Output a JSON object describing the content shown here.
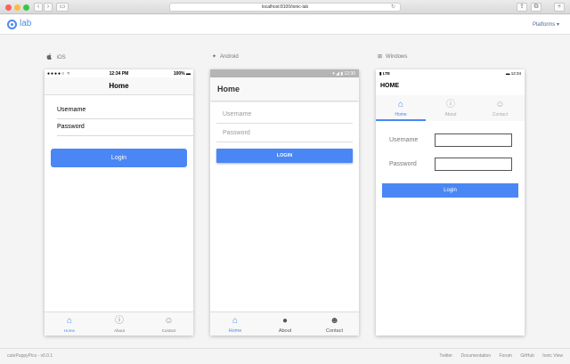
{
  "browser": {
    "url": "localhost:8100/ionic-lab",
    "back_glyph": "‹",
    "forward_glyph": "›",
    "sidebar_glyph": "▭",
    "reload_glyph": "↻",
    "share_glyph": "⇪",
    "tabs_glyph": "⧉",
    "new_tab_glyph": "+"
  },
  "lab": {
    "logo_text": "lab",
    "platforms_label": "Platforms ▾"
  },
  "platforms": {
    "ios": {
      "icon": "",
      "label": "iOS"
    },
    "android": {
      "icon": "✦",
      "label": "Android"
    },
    "windows": {
      "icon": "⊞",
      "label": "Windows"
    }
  },
  "ios": {
    "status_left": "●●●●○ ≈",
    "status_time": "12:34 PM",
    "status_battery": "100% ▬",
    "nav_title": "Home",
    "username_label": "Username",
    "password_label": "Password",
    "login_label": "Login",
    "tabs": [
      {
        "icon": "⌂",
        "label": "Home"
      },
      {
        "icon": "ⓘ",
        "label": "About"
      },
      {
        "icon": "☺",
        "label": "Contact"
      }
    ]
  },
  "android": {
    "status_right": "▾ ◢ ▮ 12:30",
    "toolbar_title": "Home",
    "username_placeholder": "Username",
    "password_placeholder": "Password",
    "login_label": "LOGIN",
    "tabs": [
      {
        "icon": "⌂",
        "label": "Home"
      },
      {
        "icon": "●",
        "label": "About"
      },
      {
        "icon": "☻",
        "label": "Contact"
      }
    ]
  },
  "windows": {
    "status_left": "▮ LTE",
    "status_right": "▬ 12:34",
    "title": "HOME",
    "username_label": "Username",
    "password_label": "Password",
    "login_label": "Login",
    "tabs": [
      {
        "icon": "⌂",
        "label": "Home"
      },
      {
        "icon": "ⓘ",
        "label": "About"
      },
      {
        "icon": "☺",
        "label": "Contact"
      }
    ]
  },
  "footer": {
    "version": "cutePuppyPics - v0.0.1",
    "links": [
      "Twitter",
      "Documentation",
      "Forum",
      "GitHub",
      "Ionic View"
    ]
  },
  "colors": {
    "accent": "#4a87f4",
    "close": "#fc605c",
    "minimize": "#fdbc40",
    "maximize": "#34c84a"
  }
}
